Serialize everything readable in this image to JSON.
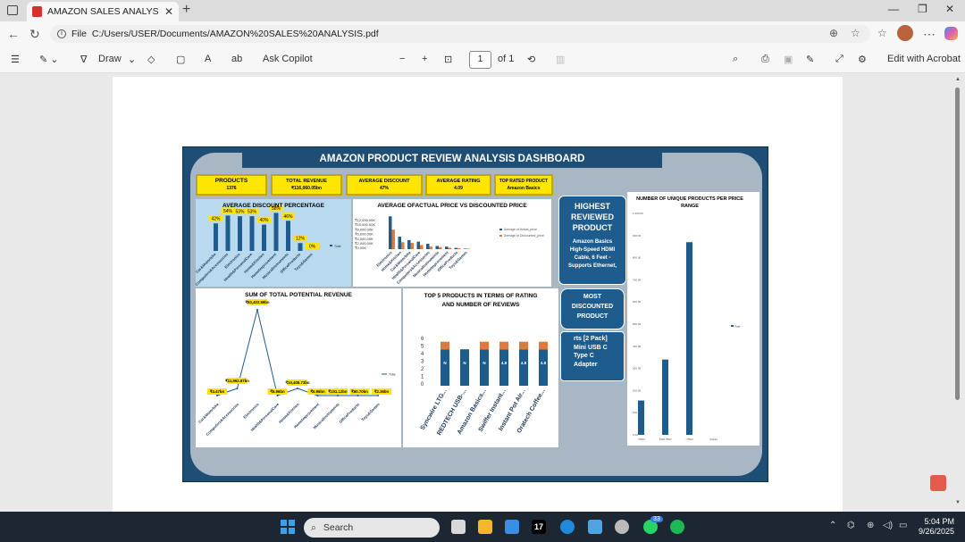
{
  "browser": {
    "tab_title": "AMAZON SALES ANALYSIS.pdf",
    "url_prefix": "File",
    "url": "C:/Users/USER/Documents/AMAZON%20SALES%20ANALYSIS.pdf"
  },
  "toolbar": {
    "draw_label": "Draw",
    "ask_copilot": "Ask Copilot",
    "page_current": "1",
    "page_total": "of 1",
    "edit_acrobat": "Edit with Acrobat"
  },
  "dashboard": {
    "title": "AMAZON PRODUCT REVIEW ANALYSIS DASHBOARD",
    "kpis": [
      {
        "label": "PRODUCTS",
        "value": "1376"
      },
      {
        "label": "TOTAL REVENUE",
        "value": "₹116,060.05bn"
      },
      {
        "label": "AVERAGE DISCOUNT",
        "value": "47%"
      },
      {
        "label": "AVERAGE RATING",
        "value": "4.09"
      },
      {
        "label": "TOP RATED PRODUCT",
        "value": "Amazon Basics"
      }
    ],
    "highest_reviewed": {
      "title_lines": [
        "HIGHEST",
        "REVIEWED",
        "PRODUCT"
      ],
      "product_lines": [
        "Amazon Basics",
        "High-Speed HDMI",
        "Cable, 6 Feet -",
        "Supports Ethernet,"
      ]
    },
    "most_discounted": {
      "title_lines": [
        "MOST",
        "DISCOUNTED",
        "PRODUCT"
      ],
      "product_lines": [
        "rts [2 Pack]",
        "Mini USB C",
        "Type C",
        "Adapter"
      ]
    }
  },
  "chart_data": [
    {
      "type": "bar",
      "title": "AVERAGE DISCOUNT PERCENTAGE",
      "categories": [
        "Car&Motorbike",
        "Computers&Accessories",
        "Electronics",
        "Health&PersonalCare",
        "Home&Kitchen",
        "HomeImprovement",
        "MusicalInstruments",
        "OfficeProducts",
        "Toys&Games"
      ],
      "values": [
        42,
        54,
        53,
        53,
        40,
        58,
        46,
        12,
        0
      ],
      "data_labels": [
        "42%",
        "54%",
        "53%",
        "53%",
        "40%",
        "58%",
        "46%",
        "12%",
        "0%"
      ],
      "legend": [
        "Total"
      ]
    },
    {
      "type": "bar",
      "title": "AVERAGE OFACTUAL PRICE VS DISCOUNTED PRICE",
      "categories": [
        "Electronics",
        "Home&Kitchen",
        "Car&Motorbike",
        "Health&PersonalCare",
        "Computers&Accessories",
        "MusicalInstruments",
        "HomeImprovement",
        "OfficeProducts",
        "Toys&Games"
      ],
      "y_ticks": [
        "₹12,000.00K",
        "₹10,000.00K",
        "₹8,000.00K",
        "₹6,000.00K",
        "₹4,000.00K",
        "₹2,000.00K",
        "₹0.00K"
      ],
      "series": [
        {
          "name": "Average of Actual_price",
          "values": [
            10500,
            4000,
            2900,
            2400,
            1700,
            1000,
            800,
            400,
            150
          ]
        },
        {
          "name": "Average of Discounted_price",
          "values": [
            6200,
            2200,
            2000,
            1300,
            800,
            650,
            450,
            300,
            150
          ]
        }
      ],
      "colors": [
        "#1e5c8e",
        "#e0793a"
      ]
    },
    {
      "type": "line",
      "title": "SUM OF TOTAL POTENTIAL REVENUE",
      "categories": [
        "Car&Motorbike",
        "Computers&Accessories",
        "Electronics",
        "Health&PersonalCare",
        "Home&Kitchen",
        "HomeImprovement",
        "MusicalInstruments",
        "OfficeProducts",
        "Toys&Games"
      ],
      "data_labels": [
        "₹4.47bn",
        "₹11,962.87bn",
        "₹93,403.59bn",
        "₹6.96bn",
        "₹10,405.73bn",
        "₹6.96bn",
        "₹151.12bn",
        "₹60.70bn",
        "₹2.36bn"
      ],
      "values": [
        4.47,
        11962.87,
        93403.59,
        6.96,
        10405.73,
        6.96,
        151.12,
        60.7,
        2.36
      ],
      "legend": [
        "Total"
      ]
    },
    {
      "type": "bar",
      "title": "TOP 5 PRODUCTS IN TERMS OF RATING AND NUMBER OF REVIEWS",
      "categories": [
        "Syncwire LTG...",
        "REDTECH USB-...",
        "Amazon Basics...",
        "Swiffer Instant...",
        "Instant Pot Air...",
        "Oratech Coffee..."
      ],
      "y_ticks": [
        "6",
        "5",
        "4",
        "3",
        "2",
        "1",
        "0"
      ],
      "ylim": [
        0,
        6
      ],
      "series": [
        {
          "name": "Rating",
          "values": [
            4.8,
            4.8,
            4.8,
            4.8,
            4.8,
            4.8
          ]
        },
        {
          "values": [
            1.0,
            0,
            1.0,
            1.0,
            1.0,
            1.0
          ]
        }
      ],
      "bar_labels": [
        "N",
        "N",
        "N",
        "4.8",
        "4.8",
        "4.8"
      ],
      "colors": [
        "#1e5c8e",
        "#e0793a"
      ]
    },
    {
      "type": "bar",
      "title": "NUMBER OF UNIQUE PRODUCTS PER PRICE RANGE",
      "y_ticks": [
        "1,000.00",
        "900.00",
        "800.00",
        "700.00",
        "600.00",
        "500.00",
        "400.00",
        "300.00",
        "200.00",
        "100.00",
        "0.00"
      ],
      "categories": [
        "<₹200",
        "₹200-₹500",
        ">₹500",
        "(blank)"
      ],
      "values": [
        155,
        340,
        870,
        0
      ],
      "ylim": [
        0,
        1000
      ],
      "legend": [
        "Total"
      ]
    }
  ],
  "taskbar": {
    "search_placeholder": "Search",
    "badge_count": "33",
    "time": "5:04 PM",
    "date": "9/26/2025"
  },
  "colors": {
    "dash_bg": "#1e4e75",
    "kpi_yellow": "#ffe500",
    "bar_blue": "#1e5c8e",
    "bar_orange": "#e0793a",
    "panel_blue": "#b8d9ee"
  }
}
